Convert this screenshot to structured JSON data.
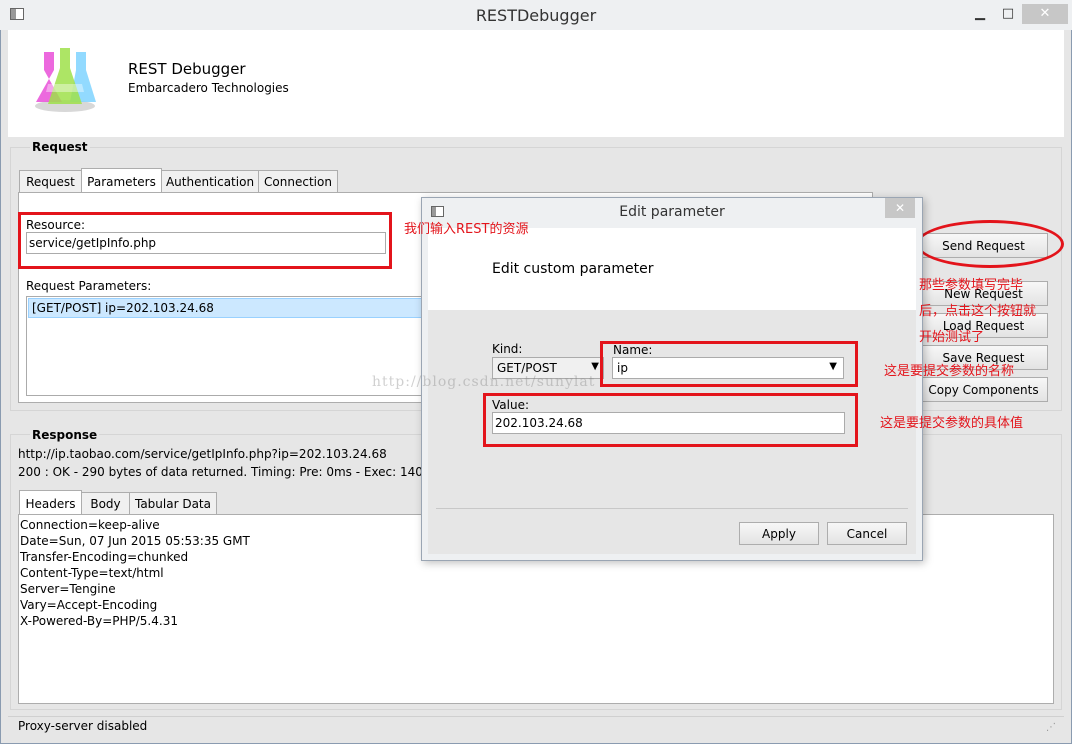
{
  "window": {
    "title": "RESTDebugger",
    "minimize": "▁",
    "maximize": "□",
    "close": "✕"
  },
  "header": {
    "app_name": "REST Debugger",
    "company": "Embarcadero Technologies"
  },
  "request": {
    "section_label": "Request",
    "tabs": [
      "Request",
      "Parameters",
      "Authentication",
      "Connection"
    ],
    "resource_label": "Resource:",
    "resource_value": "service/getIpInfo.php",
    "params_label": "Request Parameters:",
    "params": [
      "[GET/POST] ip=202.103.24.68"
    ]
  },
  "buttons": {
    "send": "Send Request",
    "new": "New Request",
    "load": "Load Request",
    "save": "Save Request",
    "copy": "Copy Components"
  },
  "response": {
    "section_label": "Response",
    "url": "http://ip.taobao.com/service/getIpInfo.php?ip=202.103.24.68",
    "status": "200 : OK - 290 bytes of data returned. Timing: Pre: 0ms - Exec: 140ms - Post:",
    "tabs": [
      "Headers",
      "Body",
      "Tabular Data"
    ],
    "headers": [
      "Connection=keep-alive",
      "Date=Sun, 07 Jun 2015 05:53:35 GMT",
      "Transfer-Encoding=chunked",
      "Content-Type=text/html",
      "Server=Tengine",
      "Vary=Accept-Encoding",
      "X-Powered-By=PHP/5.4.31"
    ]
  },
  "status_bar": {
    "text": "Proxy-server disabled"
  },
  "dialog": {
    "title": "Edit parameter",
    "heading": "Edit custom parameter",
    "close": "✕",
    "kind_label": "Kind:",
    "kind_value": "GET/POST",
    "name_label": "Name:",
    "name_value": "ip",
    "value_label": "Value:",
    "value_value": "202.103.24.68",
    "apply": "Apply",
    "cancel": "Cancel"
  },
  "annotations": {
    "resource": "我们输入REST的资源",
    "send_line1": "那些参数填写完毕",
    "send_line2": "后，点击这个按钮就",
    "send_line3": "开始测试了",
    "name": "这是要提交参数的名称",
    "value": "这是要提交参数的具体值"
  },
  "watermark": "http://blog.csdn.net/sunylat",
  "colors": {
    "annotation_red": "#e3141b",
    "selection_blue": "#cce8ff"
  }
}
